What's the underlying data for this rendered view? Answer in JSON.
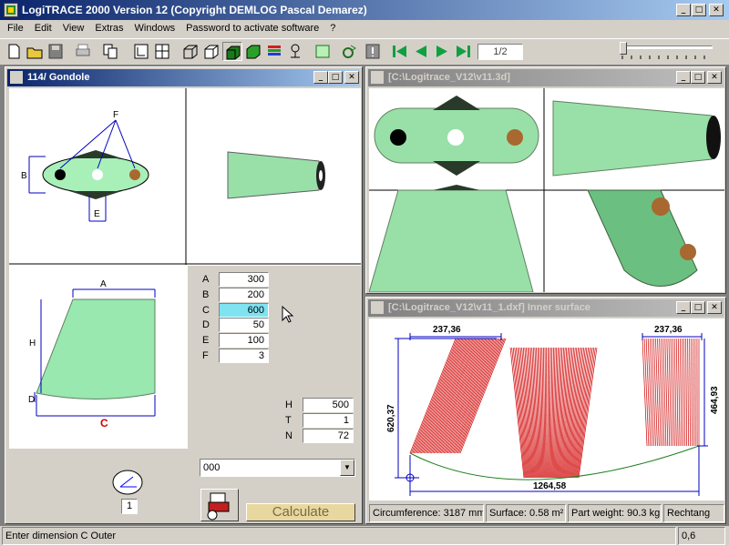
{
  "app": {
    "title": "LogiTRACE 2000  Version 12  (Copyright DEMLOG Pascal Demarez)"
  },
  "menu": [
    "File",
    "Edit",
    "View",
    "Extras",
    "Windows",
    "Password to activate software",
    "?"
  ],
  "toolbar": {
    "page": "1/2"
  },
  "win_left": {
    "title": "114/ Gondole",
    "view_labels": {
      "f": "F",
      "b": "B",
      "e": "E",
      "a": "A",
      "h": "H",
      "d": "D",
      "c": "C"
    },
    "dims": [
      {
        "label": "A",
        "value": "300"
      },
      {
        "label": "B",
        "value": "200"
      },
      {
        "label": "C",
        "value": "600"
      },
      {
        "label": "D",
        "value": "50"
      },
      {
        "label": "E",
        "value": "100"
      },
      {
        "label": "F",
        "value": "3"
      }
    ],
    "params": [
      {
        "label": "H",
        "value": "500"
      },
      {
        "label": "T",
        "value": "1"
      },
      {
        "label": "N",
        "value": "72"
      }
    ],
    "dropdown_value": "000",
    "counter_value": "1",
    "calculate_label": "Calculate"
  },
  "win_3d": {
    "title": "[C:\\Logitrace_V12\\v11.3d]"
  },
  "win_dxf": {
    "title": "[C:\\Logitrace_V12\\v11_1.dxf]  Inner surface",
    "dims": {
      "top_left": "237,36",
      "top_right": "237,36",
      "left_height": "620,37",
      "right_height": "464,93",
      "bottom_width": "1264,58"
    },
    "info": [
      "Circumference: 3187 mm",
      "Surface: 0.58 m²",
      "Part weight: 90.3 kg",
      "Rechtang"
    ]
  },
  "status": {
    "message": "Enter dimension C Outer",
    "value": "0,6"
  },
  "colors": {
    "active_title": "#0a246a",
    "highlight_field": "#7fe3f2",
    "part_green": "#98e8b0",
    "dim_blue": "#0000c0",
    "dxf_red": "#d00000"
  }
}
